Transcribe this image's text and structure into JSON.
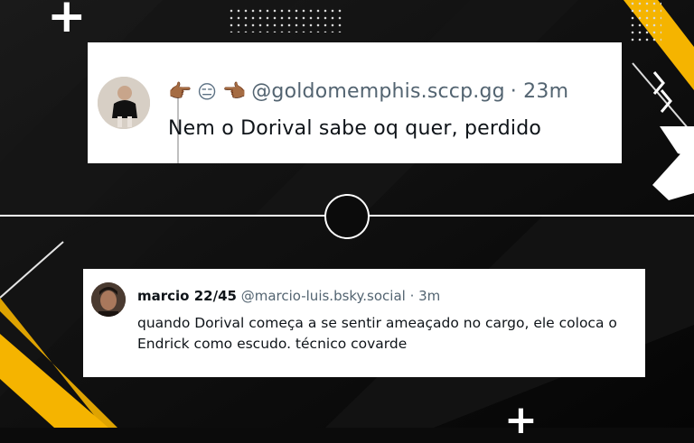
{
  "colors": {
    "background": "#0b0b0b",
    "accent_yellow": "#f5b400",
    "card_background": "#ffffff",
    "text_primary": "#0f1419",
    "text_secondary": "#536471"
  },
  "posts": [
    {
      "emoji_left": "👉🏾",
      "emoji_middle": "😑",
      "emoji_right": "👈🏾",
      "handle": "@goldomemphis.sccp.gg",
      "time": " · 23m",
      "text": "Nem o Dorival sabe oq quer, perdido",
      "avatar_icon": "avatar-photo"
    },
    {
      "name": "marcio 22/45",
      "handle": "@marcio-luis.bsky.social",
      "time": " · 3m",
      "text": "quando Dorival começa a se sentir ameaçado no cargo, ele coloca o Endrick como escudo. técnico covarde",
      "avatar_icon": "avatar-photo"
    }
  ],
  "decorations": {
    "plus_icon": "+",
    "divider_icon": "circle-icon"
  }
}
